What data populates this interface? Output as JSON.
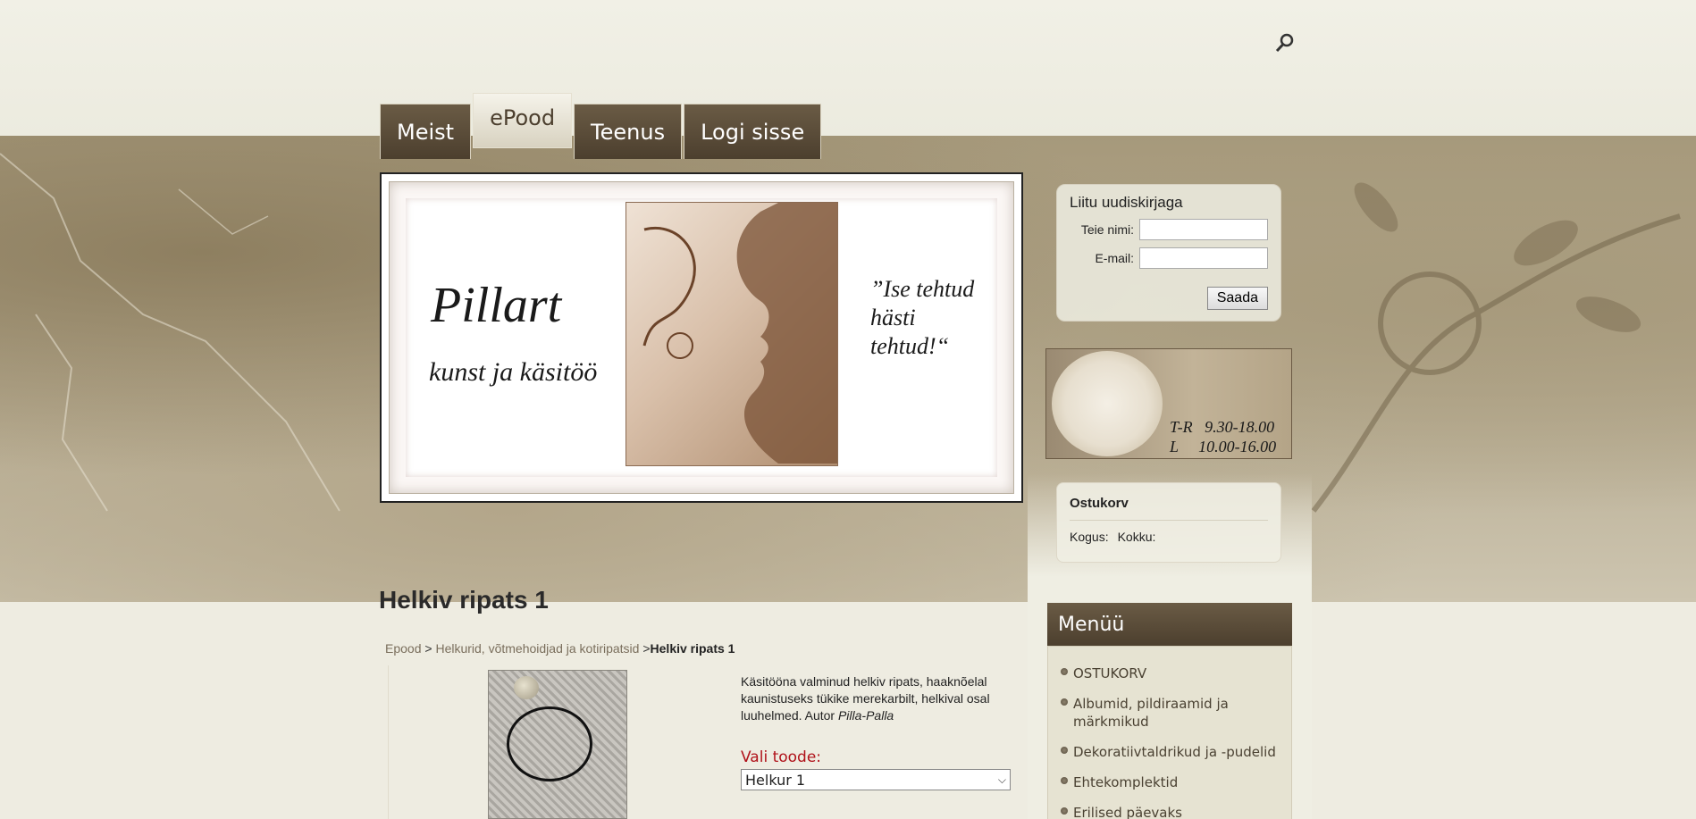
{
  "header": {
    "search_icon": "search-icon"
  },
  "nav": {
    "tabs": [
      {
        "label": "Meist",
        "selected": false
      },
      {
        "label": "ePood",
        "selected": true
      },
      {
        "label": "Teenus",
        "selected": false
      },
      {
        "label": "Logi sisse",
        "selected": false
      }
    ]
  },
  "banner": {
    "brand": "Pillart",
    "subtitle": "kunst ja käsitöö",
    "slogan": "”Ise tehtud hästi tehtud!“"
  },
  "newsletter": {
    "title": "Liitu uudiskirjaga",
    "name_label": "Teie nimi:",
    "email_label": "E-mail:",
    "name_value": "",
    "email_value": "",
    "submit_label": "Saada"
  },
  "hours": {
    "line1": "T-R   9.30-18.00",
    "line2": "L     10.00-16.00"
  },
  "cart": {
    "title": "Ostukorv",
    "qty_label": "Kogus:",
    "total_label": "Kokku:"
  },
  "menu": {
    "title": "Menüü",
    "items": [
      {
        "label": "OSTUKORV"
      },
      {
        "label": "Albumid, pildiraamid ja märkmikud"
      },
      {
        "label": "Dekoratiivtaldrikud ja -pudelid"
      },
      {
        "label": "Ehtekomplektid"
      },
      {
        "label": "Erilised päevaks"
      }
    ]
  },
  "product": {
    "title": "Helkiv ripats 1",
    "breadcrumb": {
      "root": "Epood",
      "sep": " > ",
      "category": "Helkurid, võtmehoidjad ja kotiripatsid",
      "sep2": " >",
      "current": "Helkiv ripats 1"
    },
    "description": "Käsitööna valminud helkiv ripats, haaknõelal kaunistuseks tükike merekarbilt, helkival osal luuhelmed. Autor ",
    "author": "Pilla-Palla",
    "choose_label": "Vali toode:",
    "selected_option": "Helkur 1"
  },
  "colors": {
    "accent_dark": "#4c3f2e",
    "choose_red": "#b0121a"
  }
}
